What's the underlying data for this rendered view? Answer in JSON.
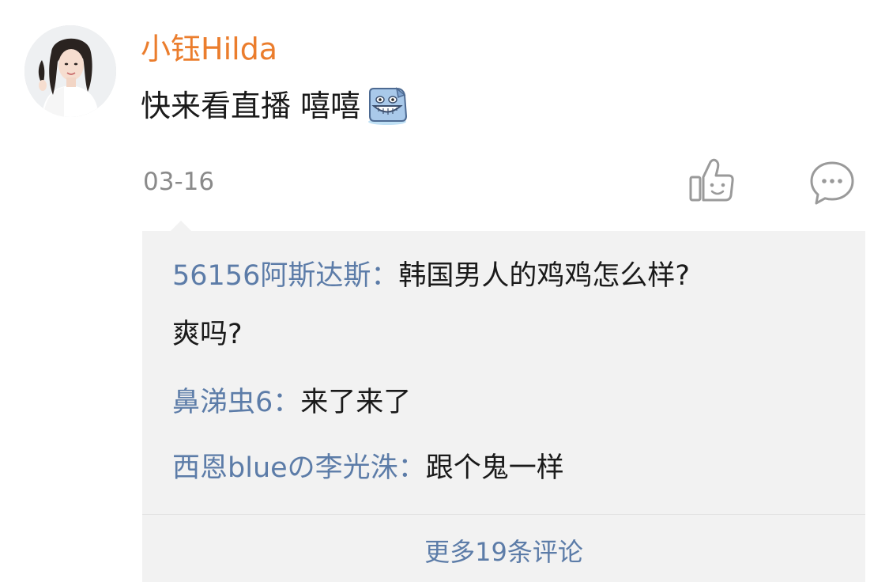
{
  "post": {
    "username": "小钰Hilda",
    "text": "快来看直播 嘻嘻",
    "date": "03-16",
    "emoji_icon": "grinning-face-emoji",
    "like_icon": "thumbs-up-icon",
    "comment_icon": "speech-bubble-icon"
  },
  "comments": [
    {
      "author": "56156阿斯达斯",
      "separator": "：",
      "text_line1": "韩国男人的鸡鸡怎么样?",
      "text_line2": "爽吗?"
    },
    {
      "author": "鼻涕虫6",
      "separator": "：",
      "text": "来了来了"
    },
    {
      "author": "西恩blueの李光洙",
      "separator": "：",
      "text": "跟个鬼一样"
    }
  ],
  "more_comments_label": "更多19条评论",
  "colors": {
    "username": "#eb7d2d",
    "link": "#5c7ca8",
    "comment_bg": "#f2f2f2",
    "text": "#1a1a1a",
    "muted": "#8a8a8a"
  }
}
